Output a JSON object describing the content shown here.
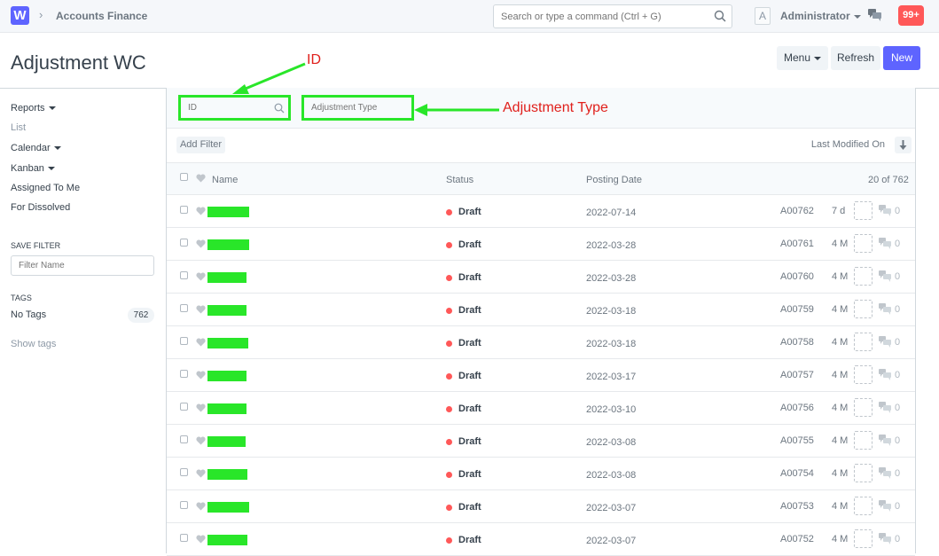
{
  "navbar": {
    "logo": "W",
    "breadcrumb": "Accounts Finance",
    "search_placeholder": "Search or type a command (Ctrl + G)",
    "avatar_letter": "A",
    "user": "Administrator",
    "notifications": "99+"
  },
  "page": {
    "title": "Adjustment WC",
    "menu_label": "Menu",
    "refresh_label": "Refresh",
    "new_label": "New"
  },
  "sidebar": {
    "reports": "Reports",
    "list": "List",
    "calendar": "Calendar",
    "kanban": "Kanban",
    "assigned": "Assigned To Me",
    "dissolved": "For Dissolved",
    "save_filter_label": "SAVE FILTER",
    "filter_name_placeholder": "Filter Name",
    "tags_label": "TAGS",
    "no_tags": "No Tags",
    "no_tags_count": "762",
    "show_tags": "Show tags"
  },
  "filters": {
    "id_placeholder": "ID",
    "adjustment_type_placeholder": "Adjustment Type",
    "add_filter": "Add Filter",
    "sort_label": "Last Modified On"
  },
  "list": {
    "headers": {
      "name": "Name",
      "status": "Status",
      "posting_date": "Posting Date",
      "count": "20 of 762"
    },
    "rows": [
      {
        "status": "Draft",
        "date": "2022-07-14",
        "id": "A00762",
        "age": "7 d",
        "comments": "0"
      },
      {
        "status": "Draft",
        "date": "2022-03-28",
        "id": "A00761",
        "age": "4 M",
        "comments": "0"
      },
      {
        "status": "Draft",
        "date": "2022-03-28",
        "id": "A00760",
        "age": "4 M",
        "comments": "0"
      },
      {
        "status": "Draft",
        "date": "2022-03-18",
        "id": "A00759",
        "age": "4 M",
        "comments": "0"
      },
      {
        "status": "Draft",
        "date": "2022-03-18",
        "id": "A00758",
        "age": "4 M",
        "comments": "0"
      },
      {
        "status": "Draft",
        "date": "2022-03-17",
        "id": "A00757",
        "age": "4 M",
        "comments": "0"
      },
      {
        "status": "Draft",
        "date": "2022-03-10",
        "id": "A00756",
        "age": "4 M",
        "comments": "0"
      },
      {
        "status": "Draft",
        "date": "2022-03-08",
        "id": "A00755",
        "age": "4 M",
        "comments": "0"
      },
      {
        "status": "Draft",
        "date": "2022-03-08",
        "id": "A00754",
        "age": "4 M",
        "comments": "0"
      },
      {
        "status": "Draft",
        "date": "2022-03-07",
        "id": "A00753",
        "age": "4 M",
        "comments": "0"
      },
      {
        "status": "Draft",
        "date": "2022-03-07",
        "id": "A00752",
        "age": "4 M",
        "comments": "0"
      }
    ]
  },
  "annotations": {
    "id_label": "ID",
    "adjustment_type_label": "Adjustment Type",
    "color": "#e0201c",
    "highlight_color": "#29e629"
  },
  "colors": {
    "primary": "#5e64ff",
    "draft_dot": "#ff5858",
    "notification": "#ff5858"
  }
}
